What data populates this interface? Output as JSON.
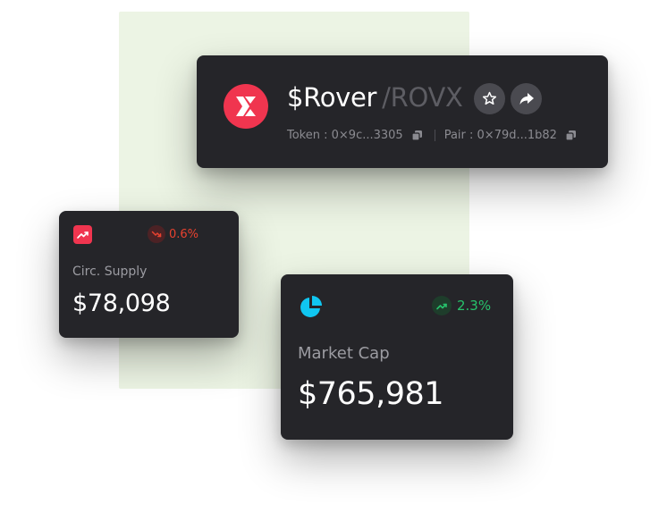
{
  "token": {
    "name": "$Rover",
    "symbol": "/ROVX",
    "token_address": "Token : 0×9c...3305",
    "pair_address": "Pair : 0×79d...1b82",
    "logo_icon": "x-logo-icon",
    "brand_color": "#f0354f"
  },
  "supply": {
    "label": "Circ. Supply",
    "value": "$78,098",
    "change": "0.6%",
    "change_direction": "down",
    "change_color": "#e8422f"
  },
  "market": {
    "label": "Market Cap",
    "value": "$765,981",
    "change": "2.3%",
    "change_direction": "up",
    "change_color": "#27c26b",
    "icon_color": "#10c6f1"
  }
}
